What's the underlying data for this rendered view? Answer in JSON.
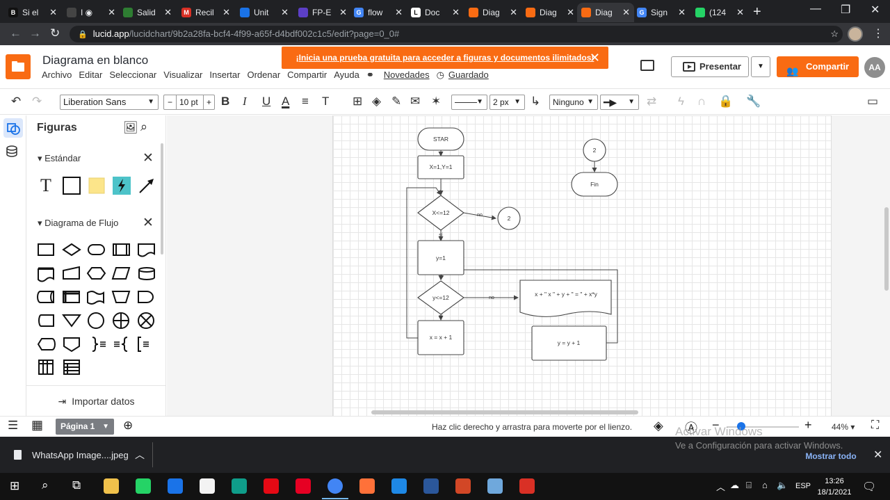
{
  "browser": {
    "tabs": [
      {
        "title": "Si el",
        "color": "#111111",
        "glyph": "B"
      },
      {
        "title": "I ◉",
        "color": "#444444",
        "glyph": ""
      },
      {
        "title": "Salid",
        "color": "#2e7d32",
        "glyph": ""
      },
      {
        "title": "Recil",
        "color": "#d93025",
        "glyph": "M"
      },
      {
        "title": "Unit",
        "color": "#1a73e8",
        "glyph": ""
      },
      {
        "title": "FP-E",
        "color": "#5c3fc6",
        "glyph": ""
      },
      {
        "title": "flow",
        "color": "#4285f4",
        "glyph": "G"
      },
      {
        "title": "Doc",
        "color": "#ffffff",
        "glyph": "L"
      },
      {
        "title": "Diag",
        "color": "#f96b13",
        "glyph": ""
      },
      {
        "title": "Diag",
        "color": "#f96b13",
        "glyph": ""
      },
      {
        "title": "Diag",
        "color": "#f96b13",
        "glyph": ""
      },
      {
        "title": "Sign",
        "color": "#4285f4",
        "glyph": "G"
      },
      {
        "title": "(124",
        "color": "#25d366",
        "glyph": ""
      }
    ],
    "active_tab_index": 10,
    "url_domain": "lucid.app",
    "url_path": "/lucidchart/9b2a28fa-bcf4-4f99-a65f-d4bdf002c1c5/edit?page=0_0#"
  },
  "header": {
    "doc_title": "Diagrama en blanco",
    "menu": [
      "Archivo",
      "Editar",
      "Seleccionar",
      "Visualizar",
      "Insertar",
      "Ordenar",
      "Compartir",
      "Ayuda"
    ],
    "novedades": "Novedades",
    "saved": "Guardado",
    "trial_banner": "¡Inicia una prueba gratuita para acceder a figuras y documentos ilimitados!",
    "present_label": "Presentar",
    "share_label": "Compartir",
    "avatar_initials": "AA",
    "accent": "#f96b13"
  },
  "toolbar": {
    "font": "Liberation Sans",
    "font_size": "10 pt",
    "line_width": "2 px",
    "endpoint": "Ninguno"
  },
  "panel": {
    "title": "Figuras",
    "section_standard": "Estándar",
    "section_flow": "Diagrama de Flujo",
    "import_label": "Importar datos",
    "standard_shapes": [
      "text",
      "rectangle",
      "note",
      "action",
      "arrow"
    ],
    "flow_shapes": [
      "process",
      "decision",
      "terminator",
      "predefined-process",
      "document",
      "multi-document",
      "manual-input",
      "preparation",
      "data",
      "database",
      "direct-access-storage",
      "internal-storage",
      "paper-tape",
      "manual-operation",
      "delay",
      "stored-data",
      "merge",
      "connector",
      "or",
      "summing-junction",
      "display",
      "off-page-link",
      "annotation-brace",
      "annotation-brace-2",
      "annotation-bracket",
      "divided-process",
      "list"
    ]
  },
  "diagram": {
    "nodes": [
      {
        "id": "start",
        "label": "STAR"
      },
      {
        "id": "init",
        "label": "X=1,Y=1"
      },
      {
        "id": "cond-x",
        "label": "X<=12"
      },
      {
        "id": "conn-2a",
        "label": "2"
      },
      {
        "id": "set-y",
        "label": "y=1"
      },
      {
        "id": "cond-y",
        "label": "y<=12"
      },
      {
        "id": "output",
        "label": "x + \" x \" + y + \" = \" + x*y"
      },
      {
        "id": "inc-y",
        "label": "y = y + 1"
      },
      {
        "id": "inc-x",
        "label": "x = x + 1"
      },
      {
        "id": "conn-2b",
        "label": "2"
      },
      {
        "id": "end",
        "label": "Fin"
      }
    ],
    "edge_labels": {
      "x_no": "no",
      "x_si": "sí",
      "y_no": "no",
      "y_si": "sí"
    }
  },
  "status": {
    "page_tab": "Página 1",
    "hint": "Haz clic derecho y arrastra para moverte por el lienzo.",
    "zoom": "44%",
    "zoom_fraction": 0.2
  },
  "watermark": {
    "line1": "Activar Windows",
    "line2": "Ve a Configuración para activar Windows."
  },
  "downloads": {
    "file": "WhatsApp Image....jpeg",
    "show_all": "Mostrar todo"
  },
  "taskbar": {
    "apps": [
      "file-explorer",
      "whatsapp",
      "mail",
      "store",
      "edge",
      "netflix",
      "pinterest",
      "chrome",
      "firefox",
      "app-blue",
      "word",
      "powerpoint",
      "3d-box",
      "acrobat"
    ],
    "language": "ESP",
    "time": "13:26",
    "date": "18/1/2021"
  }
}
